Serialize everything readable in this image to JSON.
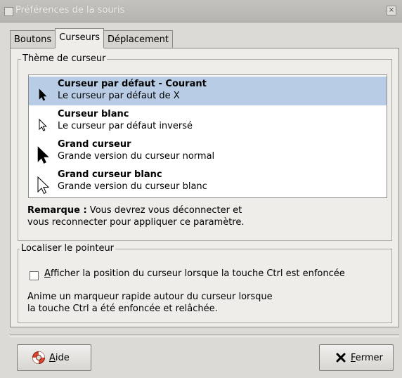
{
  "window": {
    "title": "Préférences de la souris",
    "close_glyph": "×"
  },
  "tabs": [
    {
      "label": "Boutons",
      "active": false
    },
    {
      "label": "Curseurs",
      "active": true
    },
    {
      "label": "Déplacement",
      "active": false
    }
  ],
  "cursor_theme": {
    "frame_label": "Thème de curseur",
    "items": [
      {
        "title": "Curseur par défaut - Courant",
        "subtitle": "Le curseur par défaut de X",
        "icon": "black-arrow-cursor-icon",
        "selected": true
      },
      {
        "title": "Curseur blanc",
        "subtitle": "Le curseur par défaut inversé",
        "icon": "white-arrow-cursor-icon",
        "selected": false
      },
      {
        "title": "Grand curseur",
        "subtitle": "Grande version du curseur normal",
        "icon": "large-black-arrow-cursor-icon",
        "selected": false
      },
      {
        "title": "Grand curseur blanc",
        "subtitle": "Grande version du curseur blanc",
        "icon": "large-white-arrow-cursor-icon",
        "selected": false
      }
    ],
    "note_bold": "Remarque :",
    "note_line1_rest": " Vous devrez vous déconnecter et",
    "note_line2": "vous reconnecter pour appliquer ce paramètre."
  },
  "locate_pointer": {
    "frame_label": "Localiser le pointeur",
    "checkbox_label_mnemonic": "A",
    "checkbox_label_rest": "fficher la position du curseur lorsque la touche Ctrl est enfoncée",
    "checked": false,
    "note_line1": "Anime un marqueur rapide autour du curseur lorsque",
    "note_line2": "la touche Ctrl a été enfoncée et relâchée."
  },
  "buttons": {
    "help_mnemonic": "A",
    "help_rest": "ide",
    "close_mnemonic": "F",
    "close_rest": "ermer"
  },
  "colors": {
    "selection": "#b8cce6",
    "window_bg": "#dcdad5",
    "help_icon_red": "#d8452c"
  }
}
